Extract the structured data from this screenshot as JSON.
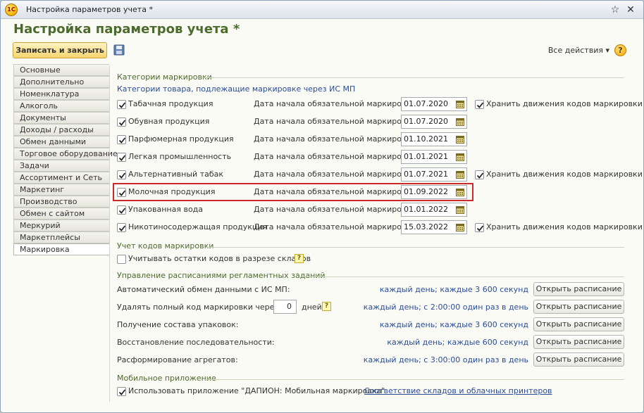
{
  "window": {
    "title": "Настройка параметров учета *"
  },
  "form": {
    "title": "Настройка параметров учета *",
    "save_close": "Записать и закрыть",
    "all_actions": "Все действия ▾",
    "help": "?"
  },
  "sidebar": {
    "items": [
      {
        "label": "Основные"
      },
      {
        "label": "Дополнительно"
      },
      {
        "label": "Номенклатура"
      },
      {
        "label": "Алкоголь"
      },
      {
        "label": "Документы"
      },
      {
        "label": "Доходы / расходы"
      },
      {
        "label": "Обмен данными"
      },
      {
        "label": "Торговое оборудование"
      },
      {
        "label": "Задачи"
      },
      {
        "label": "Ассортимент и Сеть"
      },
      {
        "label": "Маркетинг"
      },
      {
        "label": "Производство"
      },
      {
        "label": "Обмен с сайтом"
      },
      {
        "label": "Меркурий"
      },
      {
        "label": "Маркетплейсы"
      },
      {
        "label": "Маркировка"
      }
    ],
    "active": "Маркировка"
  },
  "marking": {
    "section_title": "Категории маркировки",
    "subtitle": "Категории товара, подлежащие маркировке через ИС МП",
    "date_label": "Дата начала обязательной маркировки:",
    "keep_label": "Хранить движения кодов маркировки",
    "categories": [
      {
        "label": "Табачная продукция",
        "date": "01.07.2020",
        "checked": true,
        "keep": true
      },
      {
        "label": "Обувная продукция",
        "date": "01.07.2020",
        "checked": true,
        "keep": false
      },
      {
        "label": "Парфюмерная продукция",
        "date": "01.10.2021",
        "checked": true,
        "keep": false
      },
      {
        "label": "Легкая промышленность",
        "date": "01.01.2021",
        "checked": true,
        "keep": false
      },
      {
        "label": "Альтернативный табак",
        "date": "01.07.2021",
        "checked": true,
        "keep": true
      },
      {
        "label": "Молочная продукция",
        "date": "01.09.2022",
        "checked": true,
        "keep": false
      },
      {
        "label": "Упакованная вода",
        "date": "01.01.2022",
        "checked": true,
        "keep": false
      },
      {
        "label": "Никотиносодержащая продукция",
        "date": "15.03.2022",
        "checked": true,
        "keep": true
      }
    ]
  },
  "codes": {
    "section_title": "Учет кодов маркировки",
    "warehouse_label": "Учитывать остатки кодов в разрезе складов",
    "help": "?"
  },
  "schedules": {
    "section_title": "Управление расписаниями регламентных заданий",
    "button_label": "Открыть расписание",
    "days_unit": "дней",
    "days_value": "0",
    "rows": [
      {
        "label": "Автоматический обмен данными с ИС МП:",
        "schedule": "каждый день; каждые 3 600 секунд"
      },
      {
        "label": "Удалять полный код маркировки через:",
        "schedule": "каждый день; с 2:00:00 один раз в день"
      },
      {
        "label": "Получение состава упаковок:",
        "schedule": "каждый день; каждые 3 600 секунд"
      },
      {
        "label": "Восстановление последовательности:",
        "schedule": "каждый день; каждые 600 секунд"
      },
      {
        "label": "Расформирование агрегатов:",
        "schedule": "каждый день; с 3:00:00 один раз в день"
      }
    ]
  },
  "mobile": {
    "section_title": "Мобильное приложение",
    "use_app_label": "Использовать приложение \"ДАПИОН: Мобильная маркировка\"",
    "link": "Соответствие складов и облачных принтеров"
  },
  "colors": {
    "accent": "#4b6b2c",
    "link": "#2a4d98",
    "highlight": "#cc2a2a",
    "primary_button": "#f6d56e"
  }
}
